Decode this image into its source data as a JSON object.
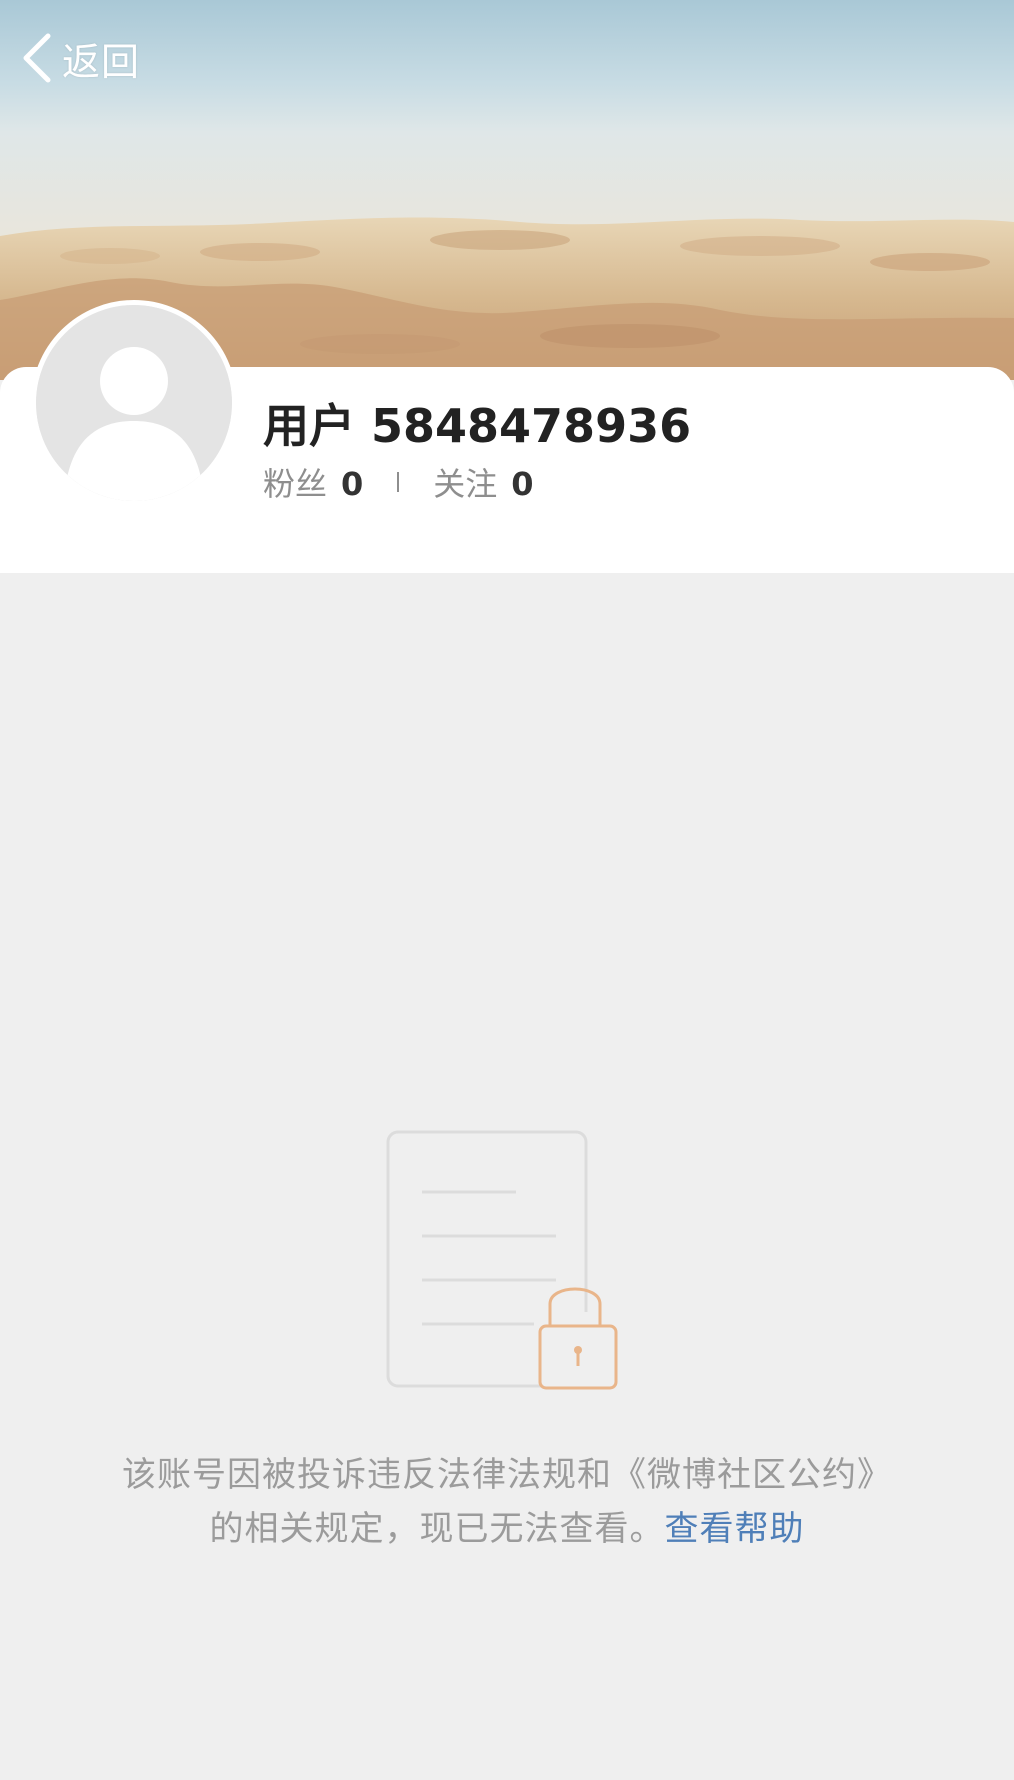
{
  "nav": {
    "back_label": "返回",
    "back_icon": "chevron-left-icon"
  },
  "profile": {
    "username": "用户 5848478936",
    "avatar_icon": "default-avatar-icon",
    "followers_label": "粉丝",
    "followers_count": "0",
    "following_label": "关注",
    "following_count": "0"
  },
  "blocked_notice": {
    "icon": "locked-document-icon",
    "message": "该账号因被投诉违反法律法规和《微博社区公约》的相关规定，现已无法查看。",
    "help_link": "查看帮助"
  },
  "colors": {
    "page_background": "#efefef",
    "card_background": "#ffffff",
    "link": "#4f7fb8",
    "lock_accent": "#e9b58a",
    "muted_text": "#9b9b9b"
  }
}
